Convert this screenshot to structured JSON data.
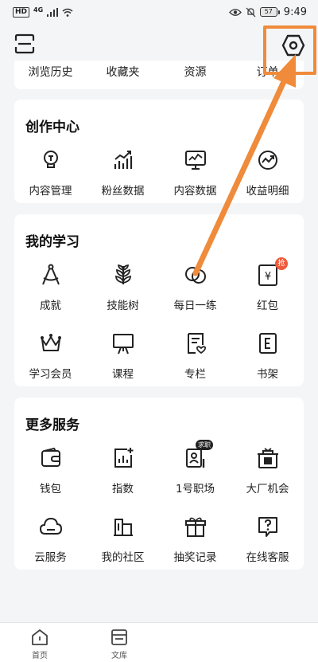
{
  "status_bar": {
    "hd": "HD",
    "network": "4G",
    "battery": "57",
    "time": "9:49"
  },
  "header": {
    "scan_icon": "scan-icon",
    "settings_icon": "settings-hexagon-icon",
    "highlight_color": "#ef8b3a"
  },
  "quick_links": [
    "浏览历史",
    "收藏夹",
    "资源",
    "订单"
  ],
  "creation_center": {
    "title": "创作中心",
    "items": [
      {
        "label": "内容管理",
        "icon": "lightbulb-icon"
      },
      {
        "label": "粉丝数据",
        "icon": "bar-chart-icon"
      },
      {
        "label": "内容数据",
        "icon": "monitor-chart-icon"
      },
      {
        "label": "收益明细",
        "icon": "earnings-icon"
      }
    ]
  },
  "my_study": {
    "title": "我的学习",
    "items": [
      {
        "label": "成就",
        "icon": "compass-icon"
      },
      {
        "label": "技能树",
        "icon": "wheat-icon"
      },
      {
        "label": "每日一练",
        "icon": "circles-icon"
      },
      {
        "label": "红包",
        "icon": "red-packet-icon",
        "badge": "抢"
      },
      {
        "label": "学习会员",
        "icon": "crown-icon"
      },
      {
        "label": "课程",
        "icon": "easel-icon"
      },
      {
        "label": "专栏",
        "icon": "column-doc-icon"
      },
      {
        "label": "书架",
        "icon": "book-e-icon"
      }
    ]
  },
  "more_services": {
    "title": "更多服务",
    "items": [
      {
        "label": "钱包",
        "icon": "wallet-icon"
      },
      {
        "label": "指数",
        "icon": "index-chart-icon"
      },
      {
        "label": "1号职场",
        "icon": "job-card-icon",
        "badge": "求职"
      },
      {
        "label": "大厂机会",
        "icon": "shop-gift-icon"
      },
      {
        "label": "云服务",
        "icon": "cloud-icon"
      },
      {
        "label": "我的社区",
        "icon": "community-icon"
      },
      {
        "label": "抽奖记录",
        "icon": "gift-icon"
      },
      {
        "label": "在线客服",
        "icon": "help-chat-icon"
      }
    ]
  },
  "bottom_nav": [
    {
      "label": "首页",
      "icon": "home-icon"
    },
    {
      "label": "文库",
      "icon": "library-icon"
    }
  ]
}
